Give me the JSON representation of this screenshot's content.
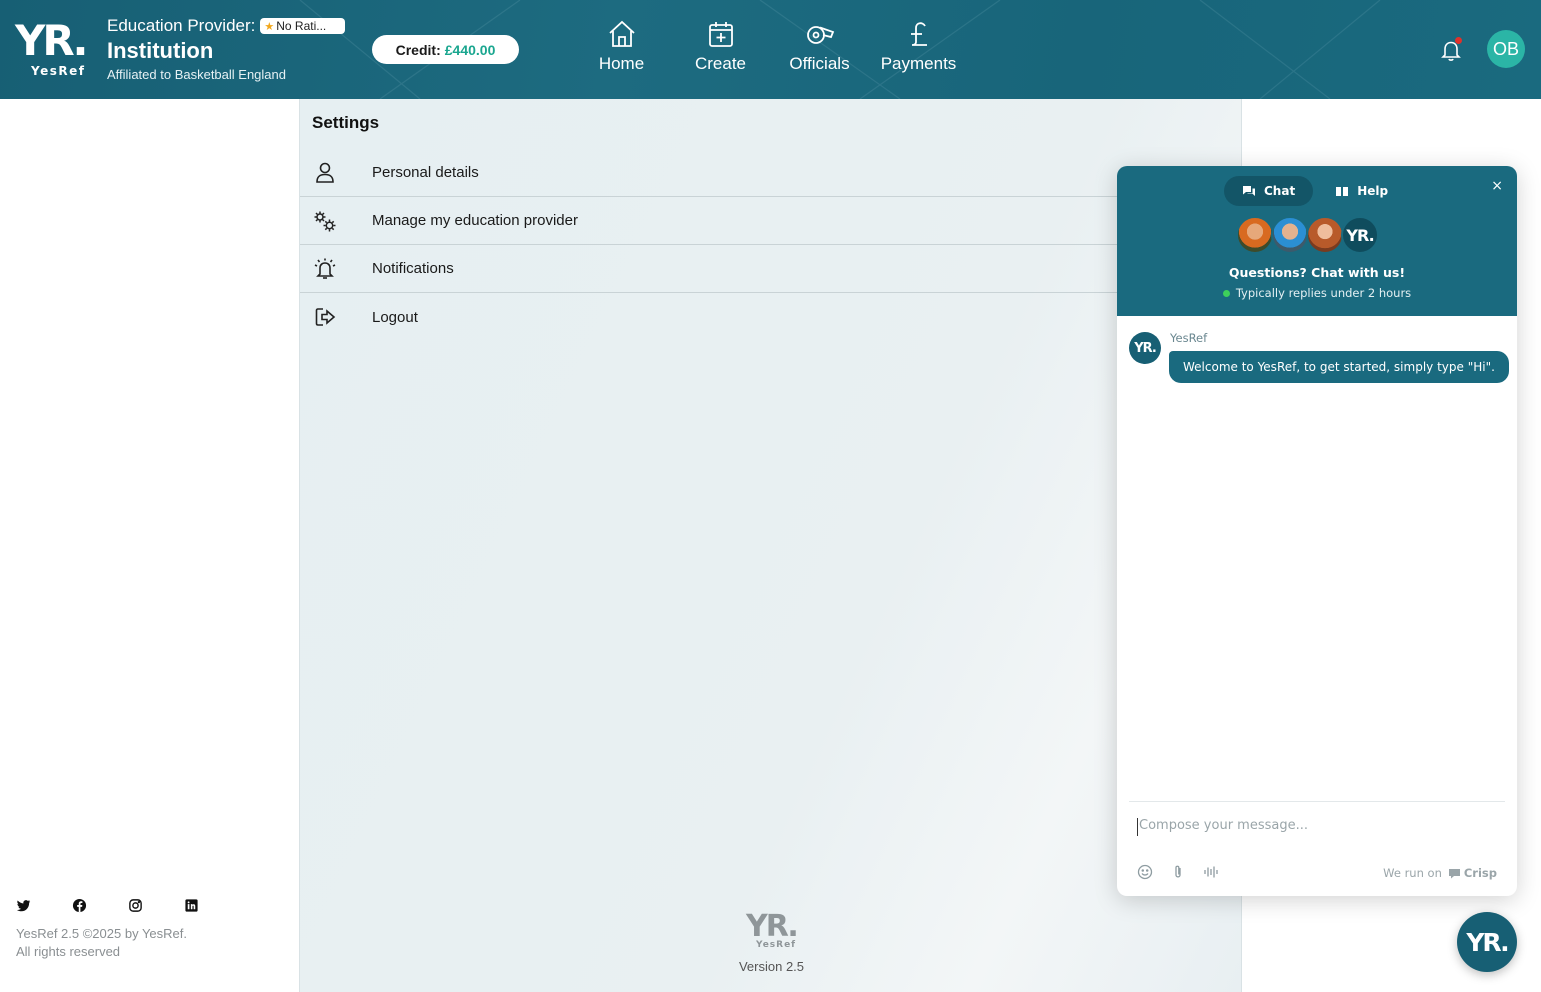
{
  "brand": {
    "logo_text": "YR.",
    "logo_sub": "YesRef"
  },
  "header": {
    "role": "Education Provider:",
    "rating": "No Rati...",
    "name": "Institution",
    "affiliation": "Affiliated to Basketball England",
    "credit_label": "Credit:",
    "credit_amount": "£440.00",
    "nav": [
      {
        "label": "Home",
        "icon": "home-icon"
      },
      {
        "label": "Create",
        "icon": "calendar-plus-icon"
      },
      {
        "label": "Officials",
        "icon": "whistle-icon"
      },
      {
        "label": "Payments",
        "icon": "pound-icon"
      }
    ],
    "avatar_initials": "OB"
  },
  "settings": {
    "title": "Settings",
    "items": [
      {
        "label": "Personal details",
        "icon": "user-icon"
      },
      {
        "label": "Manage my education provider",
        "icon": "gears-icon"
      },
      {
        "label": "Notifications",
        "icon": "bell-ringing-icon"
      },
      {
        "label": "Logout",
        "icon": "logout-icon"
      }
    ]
  },
  "footer": {
    "logo_text": "YR.",
    "logo_sub": "YesRef",
    "version": "Version 2.5",
    "social": [
      "twitter-icon",
      "facebook-icon",
      "instagram-icon",
      "linkedin-icon"
    ],
    "copyright_line1": "YesRef 2.5 ©2025 by YesRef.",
    "copyright_line2": "All rights reserved"
  },
  "chat": {
    "tab_chat": "Chat",
    "tab_help": "Help",
    "close": "×",
    "agent_logo": "YR.",
    "question": "Questions? Chat with us!",
    "reply_time": "Typically replies under 2 hours",
    "sender": "YesRef",
    "message": "Welcome to YesRef, to get started, simply type \"Hi\".",
    "compose_placeholder": "Compose your message...",
    "run_on": "We run on",
    "crisp": "Crisp",
    "launcher_text": "YR."
  },
  "colors": {
    "primary": "#1a6a7f",
    "accent": "#1aa68f",
    "avatar": "#2bb5a6"
  }
}
